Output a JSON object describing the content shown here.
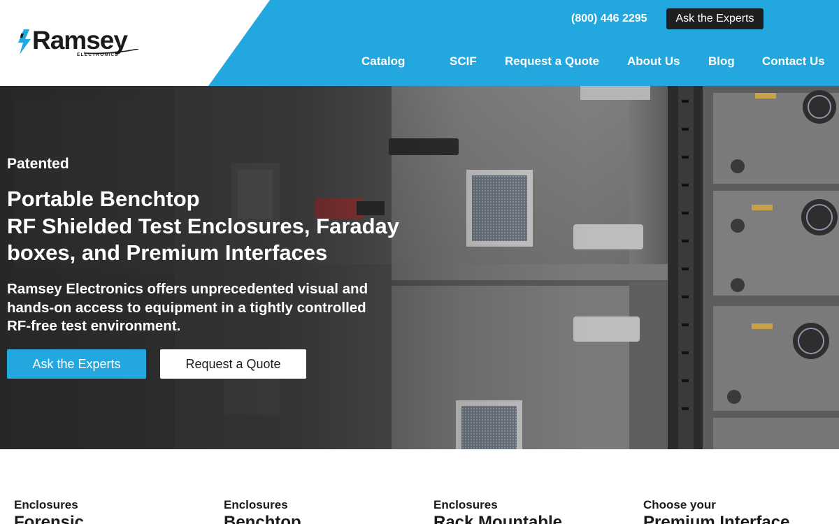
{
  "header": {
    "logo": {
      "brand": "Ramsey",
      "tagline": "ELECTRONICS"
    },
    "phone": "(800) 446 2295",
    "ask_button": "Ask the Experts",
    "nav": [
      {
        "label": "Catalog"
      },
      {
        "label": "SCIF"
      },
      {
        "label": "Request a Quote"
      },
      {
        "label": "About Us"
      },
      {
        "label": "Blog"
      },
      {
        "label": "Contact Us"
      }
    ]
  },
  "hero": {
    "eyebrow": "Patented",
    "title_lines": [
      "Portable Benchtop",
      "RF Shielded Test Enclosures, Faraday",
      "boxes, and Premium Interfaces"
    ],
    "description_lines": [
      "Ramsey Electronics offers unprecedented visual and",
      "hands-on access to equipment in a tightly controlled",
      "RF-free test environment."
    ],
    "primary_button": "Ask the Experts",
    "secondary_button": "Request a Quote"
  },
  "cards": [
    {
      "kicker": "Enclosures",
      "title": "Forensic"
    },
    {
      "kicker": "Enclosures",
      "title": "Benchtop"
    },
    {
      "kicker": "Enclosures",
      "title": "Rack Mountable"
    },
    {
      "kicker": "Choose your",
      "title": "Premium Interface"
    }
  ],
  "colors": {
    "brand_blue": "#22a7df",
    "dark": "#1f1f1f",
    "white": "#ffffff"
  },
  "icons": {
    "logo": "lightning-bolt-icon"
  }
}
